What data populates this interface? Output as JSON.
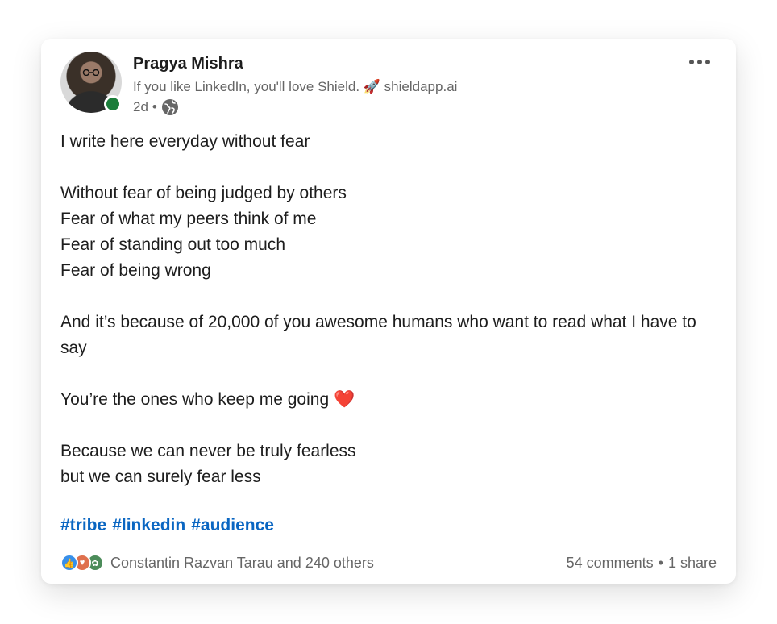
{
  "post": {
    "author": {
      "name": "Pragya Mishra",
      "headline": "If you like LinkedIn, you'll love Shield. 🚀 shieldapp.ai",
      "time": "2d",
      "separator": "•",
      "visibility_icon": "globe-icon",
      "status_color": "#1b7d3a"
    },
    "menu_icon": "more-horizontal-icon",
    "body_lines": [
      "I write here everyday without fear",
      "",
      "Without fear of being judged by others",
      "Fear of what my peers think of me",
      "Fear of standing out too much",
      "Fear of being wrong",
      "",
      "And it’s because of 20,000 of you awesome humans who want to read what I have to say",
      "",
      "You’re the ones who keep me going ❤️",
      "",
      "Because we can never be truly fearless",
      "but we can surely fear less"
    ],
    "hashtags": [
      "#tribe",
      "#linkedin",
      "#audience"
    ],
    "hashtag_color": "#0a66c2",
    "social": {
      "reaction_icons": [
        "like-icon",
        "love-icon",
        "support-icon"
      ],
      "reactors": "Constantin Razvan Tarau and 240 others",
      "comments": "54 comments",
      "separator": "•",
      "shares": "1 share"
    }
  }
}
